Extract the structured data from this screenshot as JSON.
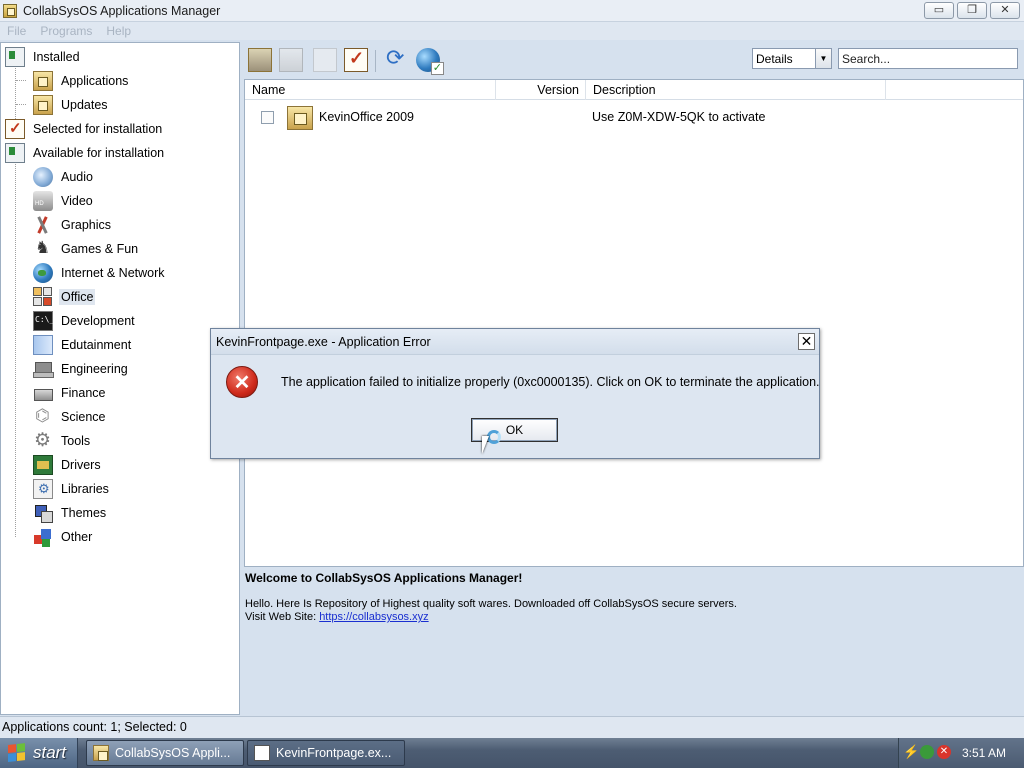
{
  "window": {
    "title": "CollabSysOS Applications Manager",
    "buttons": {
      "minimize": "▭",
      "restore": "❐",
      "close": "✕"
    }
  },
  "menu": [
    "File",
    "Programs",
    "Help"
  ],
  "tree": {
    "installed": "Installed",
    "installed_children": [
      "Applications",
      "Updates"
    ],
    "selected": "Selected for installation",
    "available": "Available for installation",
    "available_children": [
      "Audio",
      "Video",
      "Graphics",
      "Games & Fun",
      "Internet & Network",
      "Office",
      "Development",
      "Edutainment",
      "Engineering",
      "Finance",
      "Science",
      "Tools",
      "Drivers",
      "Libraries",
      "Themes",
      "Other"
    ],
    "selected_item": "Office"
  },
  "toolbar": {
    "view_value": "Details",
    "search_placeholder": "Search..."
  },
  "list": {
    "columns": [
      "Name",
      "Version",
      "Description"
    ],
    "rows": [
      {
        "name": "KevinOffice 2009",
        "version": "",
        "description": "Use Z0M-XDW-5QK to activate"
      }
    ]
  },
  "info": {
    "title": "Welcome to CollabSysOS Applications Manager!",
    "text": "Hello. Here Is Repository of Highest quality soft wares. Downloaded off CollabSysOS secure servers.",
    "visit_label": "Visit Web Site: ",
    "link": "https://collabsysos.xyz"
  },
  "status": "Applications count: 1; Selected: 0",
  "dialog": {
    "title": "KevinFrontpage.exe - Application Error",
    "message": "The application failed to initialize properly (0xc0000135). Click on OK to terminate the application.",
    "ok": "OK"
  },
  "taskbar": {
    "start": "start",
    "tasks": [
      "CollabSysOS Appli...",
      "KevinFrontpage.ex..."
    ],
    "clock": "3:51 AM"
  },
  "colors": {
    "accent": "#2f7bbf",
    "error": "#cf2a1b",
    "link": "#1a2fd0"
  }
}
